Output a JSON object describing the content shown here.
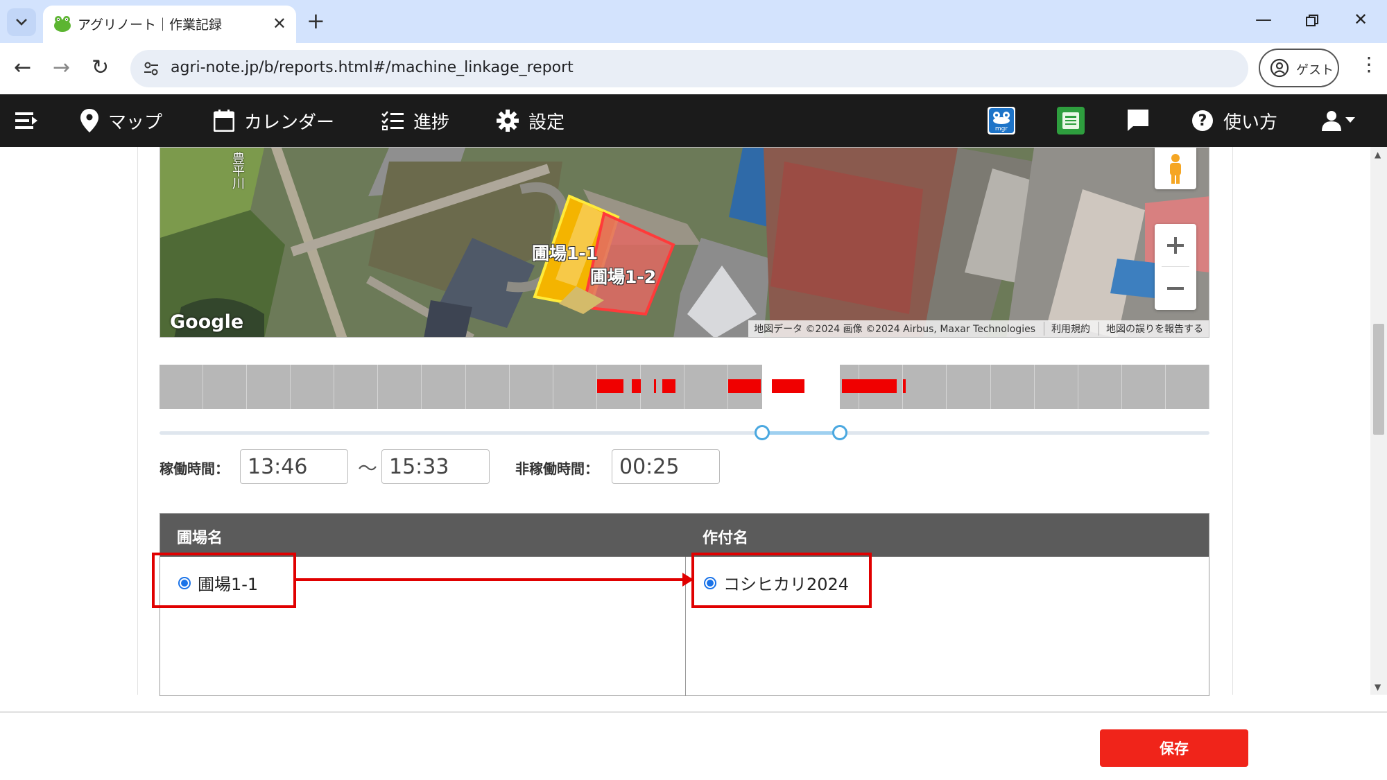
{
  "browser": {
    "tab_title": "アグリノート｜作業記録",
    "new_tab": "+",
    "url": "agri-note.jp/b/reports.html#/machine_linkage_report",
    "profile_label": "ゲスト"
  },
  "appnav": {
    "items": [
      {
        "label": "マップ",
        "icon": "map-pin-icon"
      },
      {
        "label": "カレンダー",
        "icon": "calendar-icon"
      },
      {
        "label": "進捗",
        "icon": "checklist-icon"
      },
      {
        "label": "設定",
        "icon": "gear-icon"
      }
    ],
    "help_label": "使い方",
    "mgr_badge": "mgr"
  },
  "map": {
    "field_labels": [
      "圃場1-1",
      "圃場1-2"
    ],
    "river_label": "豊平川",
    "google": "Google",
    "attribution": [
      "地図データ ©2024 画像 ©2024 Airbus, Maxar Technologies",
      "利用規約",
      "地図の誤りを報告する"
    ]
  },
  "timeline": {
    "cell_count": 24,
    "selected_range": [
      13.77,
      15.55
    ],
    "activity_hours": [
      [
        10.0,
        10.6
      ],
      [
        10.8,
        11.0
      ],
      [
        11.3,
        11.35
      ],
      [
        11.5,
        11.8
      ],
      [
        13.0,
        13.75
      ],
      [
        14.0,
        14.75
      ],
      [
        15.6,
        16.85
      ],
      [
        17.0,
        17.05
      ]
    ]
  },
  "work_time": {
    "label": "稼働時間：",
    "start": "13:46",
    "separator": "～",
    "end": "15:33",
    "idle_label": "非稼働時間：",
    "idle": "00:25"
  },
  "table": {
    "headers": [
      "圃場名",
      "作付名"
    ],
    "field_option": "圃場1-1",
    "crop_option": "コシヒカリ2024"
  },
  "footer": {
    "save_label": "保存"
  },
  "colors": {
    "nav_bg": "#1b1b1b",
    "save": "#f0241a",
    "highlight": "#e00000",
    "timeline_bar": "#f00000"
  }
}
